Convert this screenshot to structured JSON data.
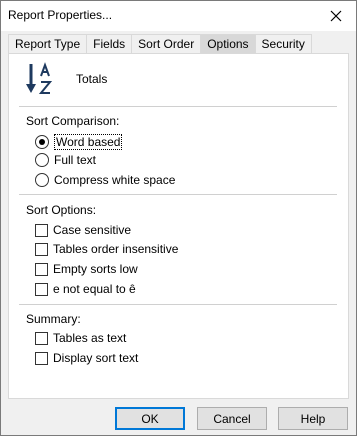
{
  "window": {
    "title": "Report Properties..."
  },
  "tabs": [
    {
      "label": "Report Type"
    },
    {
      "label": "Fields"
    },
    {
      "label": "Sort Order"
    },
    {
      "label": "Options",
      "active": true
    },
    {
      "label": "Security"
    }
  ],
  "header": {
    "title": "Totals",
    "icon": "sort-az-icon"
  },
  "sort_comparison": {
    "label": "Sort Comparison:",
    "options": [
      {
        "label": "Word based",
        "checked": true
      },
      {
        "label": "Full text",
        "checked": false
      },
      {
        "label": "Compress white space",
        "checked": false
      }
    ]
  },
  "sort_options": {
    "label": "Sort Options:",
    "items": [
      {
        "label": "Case sensitive",
        "checked": false
      },
      {
        "label": "Tables order insensitive",
        "checked": false
      },
      {
        "label": "Empty sorts low",
        "checked": false
      },
      {
        "label": "e not equal to ê",
        "checked": false
      }
    ]
  },
  "summary": {
    "label": "Summary:",
    "items": [
      {
        "label": "Tables as text",
        "checked": false
      },
      {
        "label": "Display sort text",
        "checked": false
      }
    ]
  },
  "buttons": {
    "ok": "OK",
    "cancel": "Cancel",
    "help": "Help"
  },
  "colors": {
    "accent": "#0078d7",
    "window_bg": "#f0f0f0",
    "icon": "#1e3a5f"
  }
}
